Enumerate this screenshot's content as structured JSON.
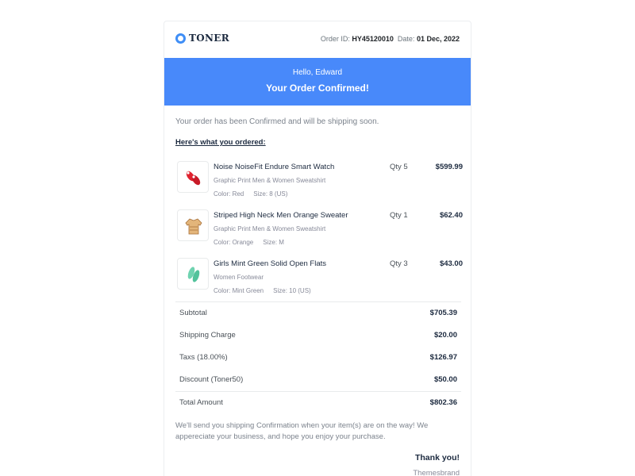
{
  "header": {
    "logo_text": "TONER",
    "order_id_label": "Order ID:",
    "order_id": "HY45120010",
    "date_label": "Date:",
    "date": "01 Dec, 2022"
  },
  "banner": {
    "greeting": "Hello, Edward",
    "title": "Your Order Confirmed!",
    "color": "#4889fa"
  },
  "intro": "Your order has been Confirmed and will be shipping soon.",
  "ordered_heading": "Here's what you ordered:",
  "items": [
    {
      "name": "Noise NoiseFit Endure Smart Watch",
      "subtitle": "Graphic Print Men & Women Sweatshirt",
      "color": "Color: Red",
      "size": "Size: 8 (US)",
      "qty": "Qty 5",
      "price": "$599.99",
      "icon": "red-shoes-icon"
    },
    {
      "name": "Striped High Neck Men Orange Sweater",
      "subtitle": "Graphic Print Men & Women Sweatshirt",
      "color": "Color: Orange",
      "size": "Size: M",
      "qty": "Qty 1",
      "price": "$62.40",
      "icon": "sweater-icon"
    },
    {
      "name": "Girls Mint Green Solid Open Flats",
      "subtitle": "Women Footwear",
      "color": "Color: Mint Green",
      "size": "Size: 10 (US)",
      "qty": "Qty 3",
      "price": "$43.00",
      "icon": "mint-flats-icon"
    }
  ],
  "summary": {
    "subtotal": {
      "label": "Subtotal",
      "value": "$705.39"
    },
    "shipping": {
      "label": "Shipping Charge",
      "value": "$20.00"
    },
    "taxes": {
      "label": "Taxs (18.00%)",
      "value": "$126.97"
    },
    "discount": {
      "label": "Discount (Toner50)",
      "value": "$50.00"
    },
    "total": {
      "label": "Total Amount",
      "value": "$802.36"
    }
  },
  "closing": "We'll send you shipping Confirmation when your item(s) are on the way! We appereciate your business, and hope you enjoy your purchase.",
  "thanks": "Thank you!",
  "brand": "Themesbrand"
}
